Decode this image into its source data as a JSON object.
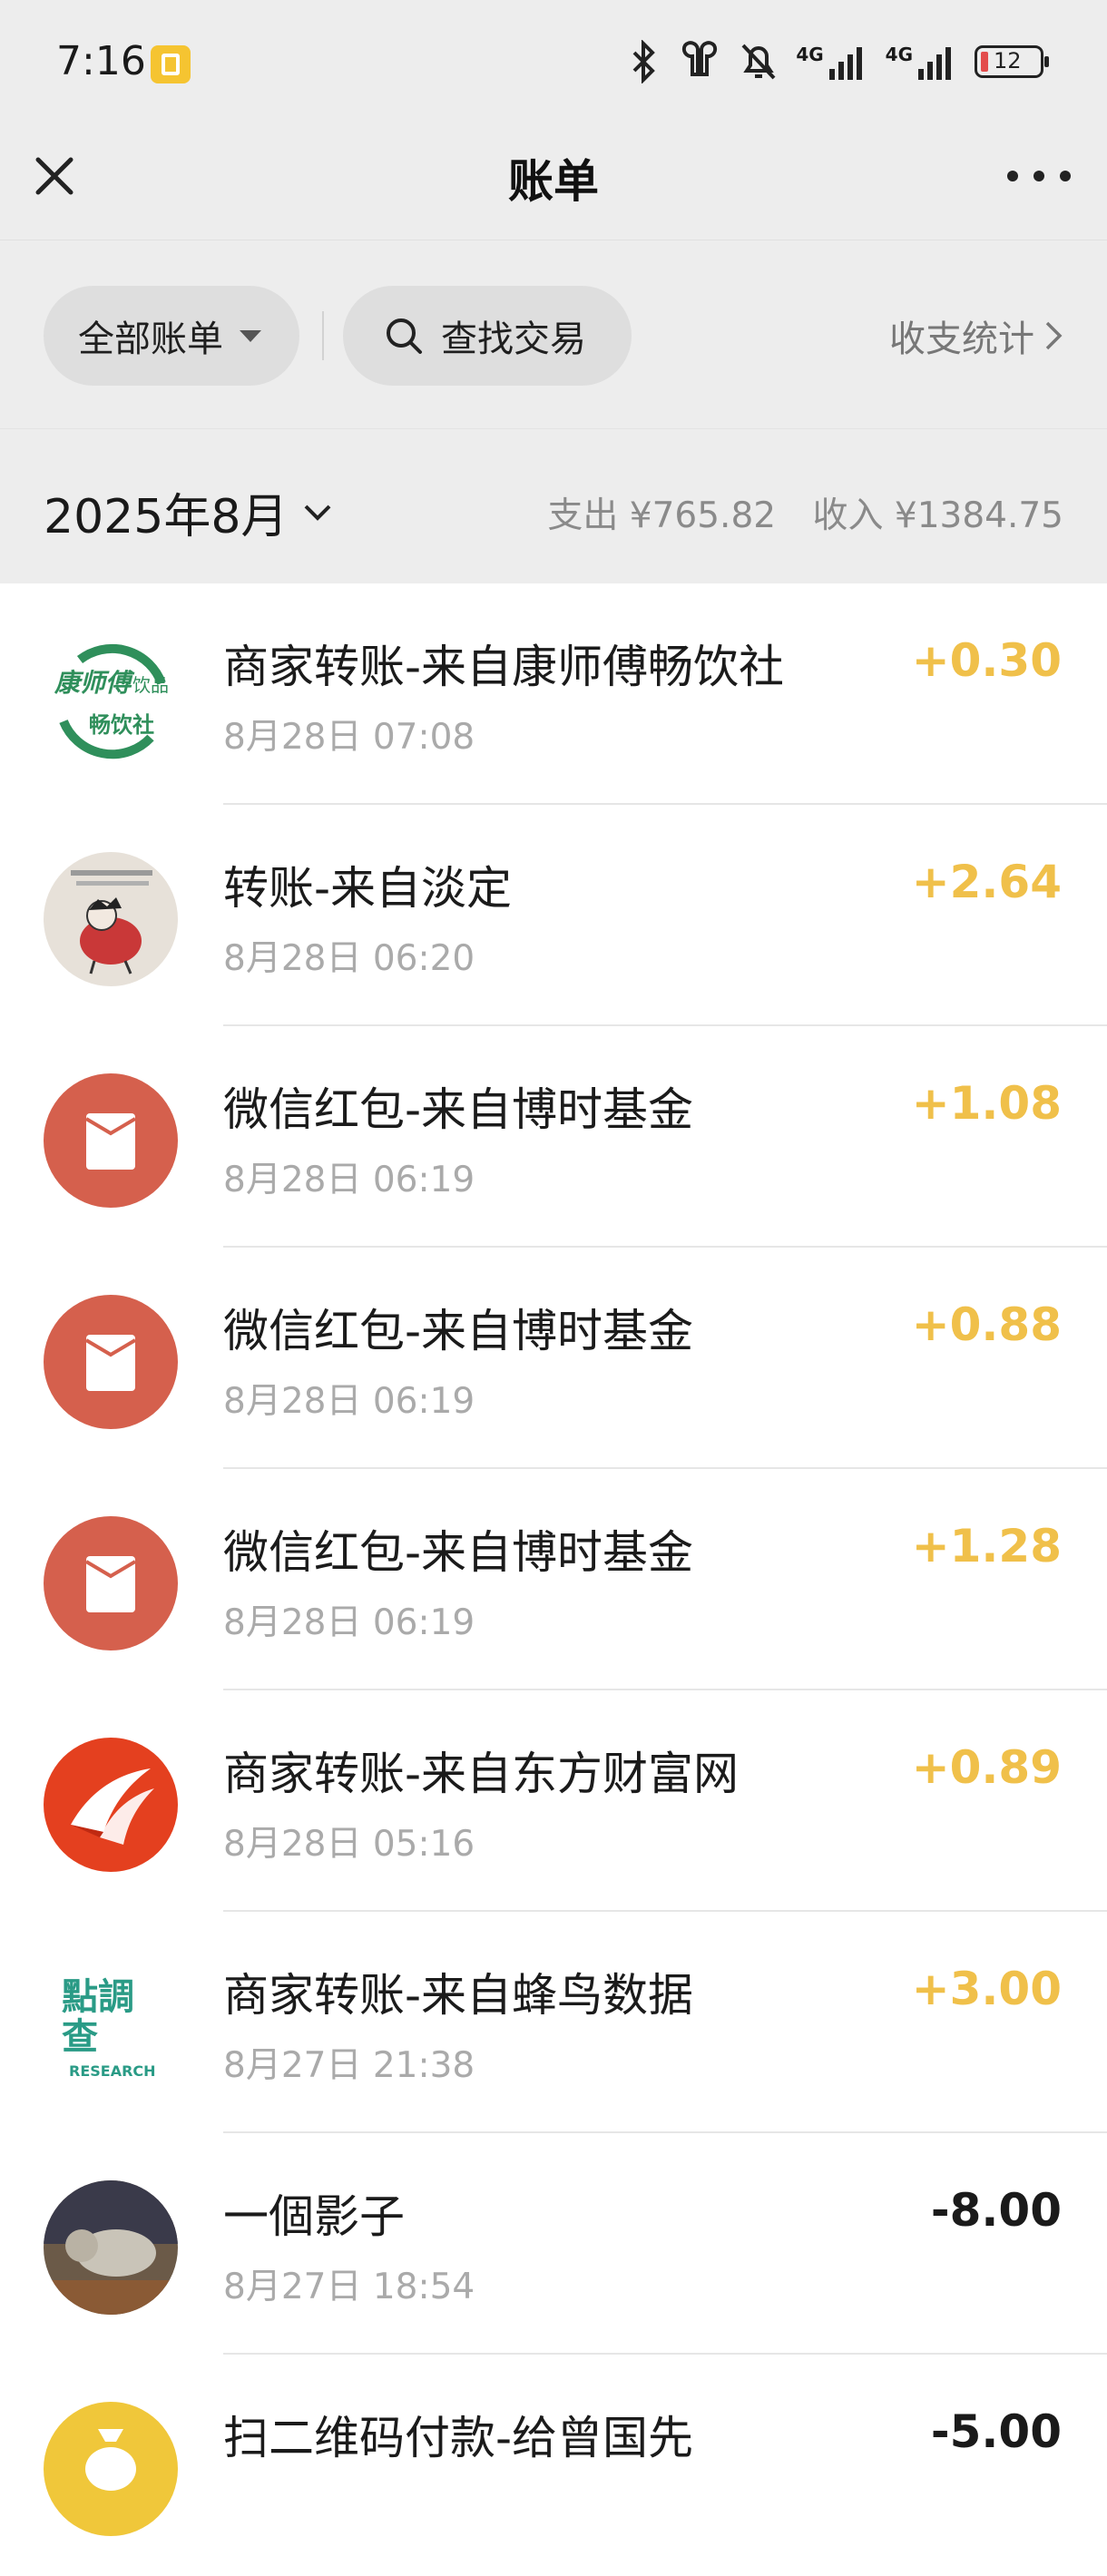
{
  "status_bar": {
    "time": "7:16",
    "battery": "12",
    "network_left": "4G",
    "network_right": "4G"
  },
  "nav": {
    "title": "账单"
  },
  "filters": {
    "all_bills": "全部账单",
    "search": "查找交易",
    "stats": "收支统计"
  },
  "month": {
    "label": "2025年8月",
    "expense": "支出 ¥765.82",
    "income": "收入 ¥1384.75"
  },
  "colors": {
    "income": "#f0c04a",
    "expense": "#1a1a1a",
    "red_packet": "#d5604d",
    "background": "#ededed"
  },
  "transactions": [
    {
      "title": "商家转账-来自康师傅畅饮社",
      "time": "8月28日 07:08",
      "amount": "+0.30",
      "type": "income",
      "icon": "kangshifu-logo",
      "logo_text_top": "康师傅",
      "logo_text_side": "饮品",
      "logo_text_bottom": "畅饮社"
    },
    {
      "title": "转账-来自淡定",
      "time": "8月28日 06:20",
      "amount": "+2.64",
      "type": "income",
      "icon": "user-avatar-cartoon"
    },
    {
      "title": "微信红包-来自博时基金",
      "time": "8月28日 06:19",
      "amount": "+1.08",
      "type": "income",
      "icon": "red-packet-icon"
    },
    {
      "title": "微信红包-来自博时基金",
      "time": "8月28日 06:19",
      "amount": "+0.88",
      "type": "income",
      "icon": "red-packet-icon"
    },
    {
      "title": "微信红包-来自博时基金",
      "time": "8月28日 06:19",
      "amount": "+1.28",
      "type": "income",
      "icon": "red-packet-icon"
    },
    {
      "title": "商家转账-来自东方财富网",
      "time": "8月28日 05:16",
      "amount": "+0.89",
      "type": "income",
      "icon": "eastmoney-logo"
    },
    {
      "title": "商家转账-来自蜂鸟数据",
      "time": "8月27日 21:38",
      "amount": "+3.00",
      "type": "income",
      "icon": "research-logo",
      "logo_text_big": "點調查",
      "logo_text_small": "RESEARCH"
    },
    {
      "title": "一個影子",
      "time": "8月27日 18:54",
      "amount": "-8.00",
      "type": "expense",
      "icon": "user-avatar-photo"
    },
    {
      "title": "扫二维码付款-给曾国先",
      "time": "",
      "amount": "-5.00",
      "type": "expense",
      "icon": "money-bag-icon"
    }
  ]
}
